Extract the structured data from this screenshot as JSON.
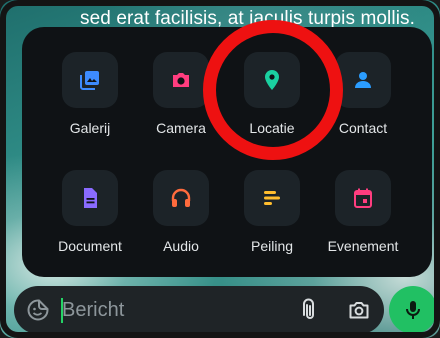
{
  "chat": {
    "message_fragment": "sed erat facilisis, at iaculis turpis mollis."
  },
  "attach_menu": {
    "items": [
      {
        "label": "Galerij",
        "icon": "gallery-icon",
        "color": "#3d8bff"
      },
      {
        "label": "Camera",
        "icon": "camera-icon",
        "color": "#ff3d7f"
      },
      {
        "label": "Locatie",
        "icon": "location-pin-icon",
        "color": "#1ad0a0"
      },
      {
        "label": "Contact",
        "icon": "contact-person-icon",
        "color": "#2b9dff"
      },
      {
        "label": "Document",
        "icon": "document-icon",
        "color": "#8a6bff"
      },
      {
        "label": "Audio",
        "icon": "headphones-icon",
        "color": "#ff6b3d"
      },
      {
        "label": "Peiling",
        "icon": "poll-icon",
        "color": "#ffbd2e"
      },
      {
        "label": "Evenement",
        "icon": "calendar-event-icon",
        "color": "#ff3d7f"
      }
    ]
  },
  "composer": {
    "placeholder": "Bericht",
    "accent": "#25d366"
  },
  "annotation": {
    "ring_color": "#ee1111"
  }
}
